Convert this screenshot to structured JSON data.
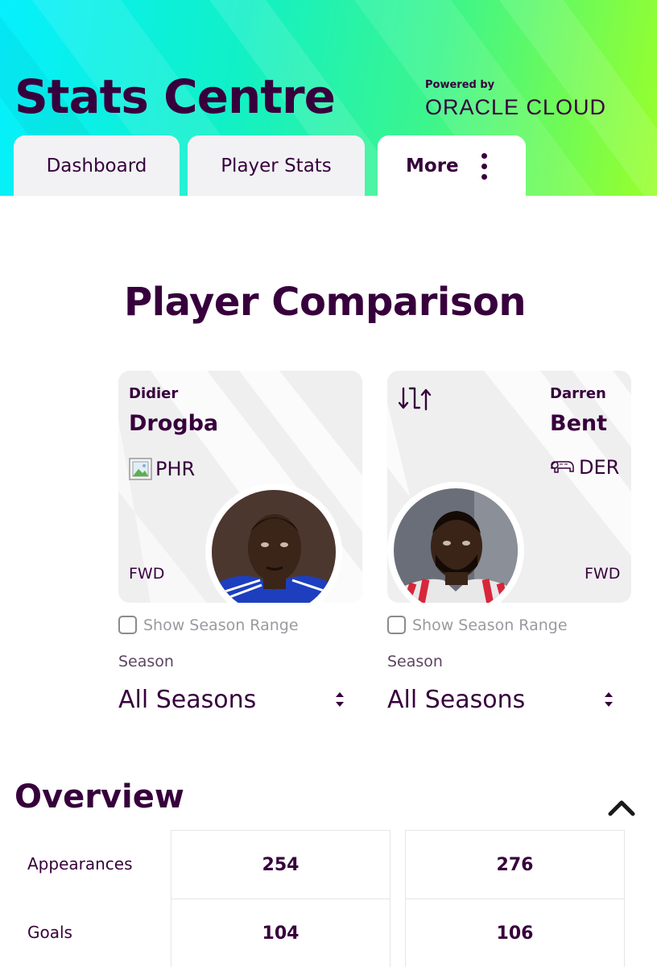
{
  "header": {
    "title": "Stats Centre",
    "powered_by": "Powered by",
    "sponsor": "ORACLE CLOUD",
    "colors": {
      "brand": "#37003c",
      "gradient_start": "#05f0ff",
      "gradient_end": "#9aff2a"
    }
  },
  "tabs": [
    {
      "label": "Dashboard",
      "active": false
    },
    {
      "label": "Player Stats",
      "active": false
    },
    {
      "label": "More",
      "active": true,
      "icon": "more-vertical-icon"
    }
  ],
  "page": {
    "heading": "Player Comparison"
  },
  "players": [
    {
      "first_name": "Didier",
      "last_name": "Drogba",
      "club": "PHR",
      "club_icon": "broken-image-icon",
      "position": "FWD",
      "show_season_range": "Show Season Range",
      "season_label": "Season",
      "season_value": "All Seasons"
    },
    {
      "first_name": "Darren",
      "last_name": "Bent",
      "club": "DER",
      "club_icon": "ram-badge-icon",
      "position": "FWD",
      "show_season_range": "Show Season Range",
      "season_label": "Season",
      "season_value": "All Seasons",
      "action_icon": "swap-player-icon"
    }
  ],
  "overview": {
    "heading": "Overview",
    "rows": [
      {
        "label": "Appearances",
        "values": [
          "254",
          "276"
        ]
      },
      {
        "label": "Goals",
        "values": [
          "104",
          "106"
        ]
      }
    ]
  }
}
